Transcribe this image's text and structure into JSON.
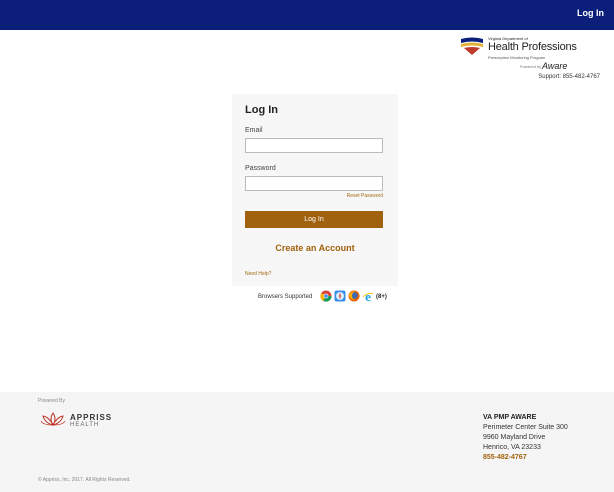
{
  "header": {
    "login_link": "Log In"
  },
  "brand": {
    "department": "Virginia Department of",
    "title": "Health Professions",
    "program": "Prescription Monitoring Program",
    "powered_by": "Powered by",
    "product": "Aware",
    "support": "Support: 855-482-4767",
    "colors": {
      "blue": "#0b1f7a",
      "gold": "#e2b23b",
      "red": "#c0392b"
    }
  },
  "login": {
    "title": "Log In",
    "email_label": "Email",
    "email_value": "",
    "password_label": "Password",
    "password_value": "",
    "reset_link": "Reset Password",
    "submit_label": "Log In",
    "create_account": "Create an Account",
    "help_link": "Need Help?"
  },
  "browsers": {
    "label": "Browsers Supported",
    "icons": [
      "chrome-icon",
      "safari-icon",
      "firefox-icon",
      "internet-explorer-icon"
    ],
    "count": "(8+)"
  },
  "footer": {
    "powered_by": "Powered By",
    "company_name": "APPRISS",
    "company_sub": "HEALTH",
    "copyright": "© Appriss, Inc. 2017. All Rights Reserved.",
    "address": {
      "org": "VA PMP AWARE",
      "line1": "Perimeter Center Suite 300",
      "line2": "9960 Mayland Drive",
      "line3": "Henrico, VA 23233",
      "phone": "855-482-4767"
    }
  },
  "theme": {
    "topbar": "#0b1f7a",
    "accent": "#a1620f"
  }
}
